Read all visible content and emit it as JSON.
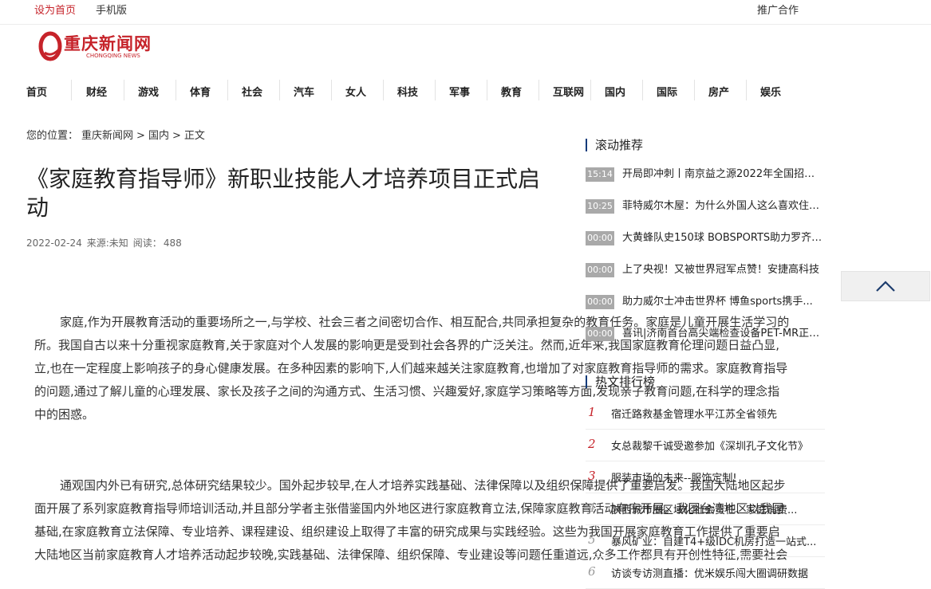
{
  "topbar": {
    "set_home": "设为首页",
    "mobile": "手机版",
    "promote": "推广合作"
  },
  "logo": {
    "text_cn": "重庆新闻网",
    "text_en": "CHONGQING NEWS"
  },
  "nav": {
    "items": [
      "首页",
      "财经",
      "游戏",
      "体育",
      "社会",
      "汽车",
      "女人",
      "科技",
      "军事",
      "教育",
      "互联网",
      "国内",
      "国际",
      "房产",
      "娱乐"
    ]
  },
  "breadcrumb": {
    "label": "您的位置：",
    "site": "重庆新闻网",
    "sep1": ">",
    "category": "国内",
    "sep2": ">",
    "current": "正文"
  },
  "article": {
    "title": "《家庭教育指导师》新职业技能人才培养项目正式启动",
    "date": "2022-02-24",
    "source": "来源:未知",
    "views_label": "阅读：",
    "views": "488",
    "para1": [
      "家庭,作为开展教育活动的重要场所之一,与学校、社会三者之间密切合作、相互配合,共同承担复杂的教育任务。家庭是儿童开展生活学习的",
      "所。我国自古以来十分重视家庭教育,关于家庭对个人发展的影响更是受到社会各界的广泛关注。然而,近年来,我国家庭教育伦理问题日益凸显,",
      "立,也在一定程度上影响孩子的身心健康发展。在多种因素的影响下,人们越来越关注家庭教育,也增加了对家庭教育指导师的需求。家庭教育指导",
      "的问题,通过了解儿童的心理发展、家长及孩子之间的沟通方式、生活习惯、兴趣爱好,家庭学习策略等方面,发现亲子教育问题,在科学的理念指",
      "中的困惑。"
    ],
    "para2": [
      "通观国内外已有研究,总体研究结果较少。国外起步较早,在人才培养实践基础、法律保障以及组织保障提供了重要启发。我国大陆地区起步",
      "面开展了系列家庭教育指导师培训活动,并且部分学者主张借鉴国内外地区进行家庭教育立法,保障家庭教育活动有序开展。我国台湾地区以我国",
      "基础,在家庭教育立法保障、专业培养、课程建设、组织建设上取得了丰富的研究成果与实践经验。这些为我国开展家庭教育工作提供了重要启",
      "大陆地区当前家庭教育人才培养活动起步较晚,实践基础、法律保障、组织保障、专业建设等问题任重道远,众多工作都具有开创性特征,需要社会"
    ]
  },
  "sidebar": {
    "scroll_title": "滚动推荐",
    "scroll_items": [
      {
        "time": "15:14",
        "text": "开局即冲刺丨南京益之源2022年全国招商会圆满举办"
      },
      {
        "time": "10:25",
        "text": "菲特威尔木屋：为什么外国人这么喜欢住木屋"
      },
      {
        "time": "00:00",
        "text": "大黄蜂队史150球 BOBSPORTS助力罗齐尔创纪录"
      },
      {
        "time": "00:00",
        "text": "上了央视！又被世界冠军点赞！安捷高科技"
      },
      {
        "time": "00:00",
        "text": "助力威尔士冲击世界杯 博鱼sports携手..."
      },
      {
        "time": "00:00",
        "text": "喜讯|济南首台高尖端检查设备PET-MR正式..."
      }
    ],
    "hot_title": "热文排行榜",
    "hot_items": [
      {
        "num": "1",
        "text": "宿迁路救基金管理水平江苏全省领先"
      },
      {
        "num": "2",
        "text": "女总裁黎千诚受邀参加《深圳孔子文化节》"
      },
      {
        "num": "3",
        "text": "服装市场的未来--服饰定制!"
      },
      {
        "num": "4",
        "text": "陕西城市圈区域化社会责任、家庭消费..."
      },
      {
        "num": "5",
        "text": "暴风矿业：自建T4+级IDC机房打造一站式..."
      },
      {
        "num": "6",
        "text": "访谈专访测直播：优米娱乐闯大圈调研数据"
      }
    ]
  },
  "colors": {
    "brand_red": "#c6232a",
    "accent_blue": "#0f3a7a",
    "time_badge": "#a9a9a9"
  },
  "icons": {
    "back_to_top": "chevron-up-icon"
  }
}
